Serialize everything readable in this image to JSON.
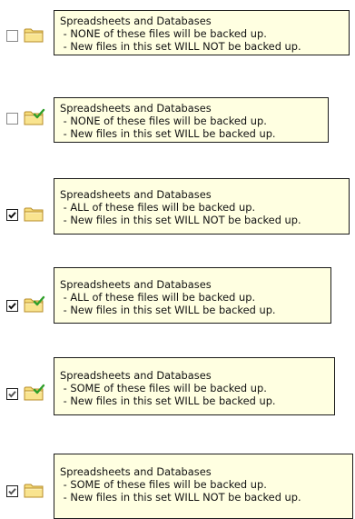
{
  "colors": {
    "tooltip_bg": "#ffffe1",
    "tooltip_border": "#1a1a1a",
    "folder_yellow": "#f2d36b",
    "folder_outline": "#b78c28",
    "check_green": "#2f9f2a"
  },
  "rows": [
    {
      "checkbox": "unchecked",
      "folder_icon": "folder-icon",
      "tooltip": {
        "title": "Spreadsheets and Databases",
        "line1": " - NONE of these files will be backed up.",
        "line2": " - New files in this set WILL NOT be backed up."
      }
    },
    {
      "checkbox": "unchecked",
      "folder_icon": "folder-new-files-icon",
      "tooltip": {
        "title": "Spreadsheets and Databases",
        "line1": " - NONE of these files will be backed up.",
        "line2": " - New files in this set WILL be backed up."
      }
    },
    {
      "checkbox": "checked",
      "folder_icon": "folder-icon",
      "tooltip": {
        "title": "Spreadsheets and Databases",
        "line1": " - ALL of these files will be backed up.",
        "line2": " - New files in this set WILL NOT be backed up."
      }
    },
    {
      "checkbox": "checked",
      "folder_icon": "folder-new-files-icon",
      "tooltip": {
        "title": "Spreadsheets and Databases",
        "line1": " - ALL of these files will be backed up.",
        "line2": " - New files in this set WILL be backed up."
      }
    },
    {
      "checkbox": "partial",
      "folder_icon": "folder-new-files-icon",
      "tooltip": {
        "title": "Spreadsheets and Databases",
        "line1": " - SOME of these files will be backed up.",
        "line2": " - New files in this set WILL be backed up."
      }
    },
    {
      "checkbox": "partial",
      "folder_icon": "folder-icon",
      "tooltip": {
        "title": "Spreadsheets and Databases",
        "line1": " - SOME of these files will be backed up.",
        "line2": " - New files in this set WILL NOT be backed up."
      }
    }
  ]
}
